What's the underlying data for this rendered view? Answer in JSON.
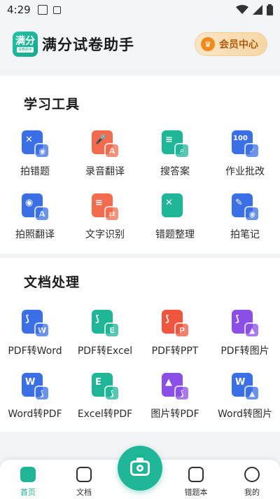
{
  "status_bar": {
    "time": "4:29",
    "icons": [
      "photo-notification-icon",
      "app-notification-icon",
      "wifi-icon",
      "signal-icon",
      "battery-icon"
    ]
  },
  "header": {
    "logo": {
      "text": "满分",
      "small": "试卷助手"
    },
    "title": "满分试卷助手",
    "vip_label": "会员中心",
    "vip_icon": "crown-icon"
  },
  "learning_tools": {
    "title": "学习工具",
    "items": [
      {
        "label": "拍错题",
        "icon": "wrong-question-camera-icon",
        "color": "#3b6fe6",
        "mark": "✕",
        "sub": "◉"
      },
      {
        "label": "录音翻译",
        "icon": "recording-translate-icon",
        "color": "#f26b4e",
        "mark": "🎤",
        "sub": "A"
      },
      {
        "label": "搜答案",
        "icon": "search-answer-icon",
        "color": "#1fb597",
        "mark": "≡",
        "sub": "⌕"
      },
      {
        "label": "作业批改",
        "icon": "homework-correction-icon",
        "color": "#3b6fe6",
        "mark": "100",
        "sub": "✓"
      },
      {
        "label": "拍照翻译",
        "icon": "photo-translate-icon",
        "color": "#3b6fe6",
        "mark": "◉",
        "sub": "A"
      },
      {
        "label": "文字识别",
        "icon": "text-recognition-icon",
        "color": "#f26b4e",
        "mark": "≡",
        "sub": "⇄"
      },
      {
        "label": "错题整理",
        "icon": "wrong-question-organize-icon",
        "color": "#1fb597",
        "mark": "✕",
        "sub": ""
      },
      {
        "label": "拍笔记",
        "icon": "note-camera-icon",
        "color": "#3b6fe6",
        "mark": "✎",
        "sub": "◉"
      }
    ]
  },
  "document_tools": {
    "title": "文档处理",
    "items": [
      {
        "label": "PDF转Word",
        "icon": "pdf-to-word-icon",
        "color": "#3b6fe6",
        "mark": "⟆",
        "sub": "W"
      },
      {
        "label": "PDF转Excel",
        "icon": "pdf-to-excel-icon",
        "color": "#1fb597",
        "mark": "⟆",
        "sub": "E"
      },
      {
        "label": "PDF转PPT",
        "icon": "pdf-to-ppt-icon",
        "color": "#f0553e",
        "mark": "⟆",
        "sub": "P"
      },
      {
        "label": "PDF转图片",
        "icon": "pdf-to-image-icon",
        "color": "#8a4fe6",
        "mark": "⟆",
        "sub": "▲"
      },
      {
        "label": "Word转PDF",
        "icon": "word-to-pdf-icon",
        "color": "#3b6fe6",
        "mark": "W",
        "sub": "⟆"
      },
      {
        "label": "Excel转PDF",
        "icon": "excel-to-pdf-icon",
        "color": "#1fb597",
        "mark": "E",
        "sub": "⟆"
      },
      {
        "label": "图片转PDF",
        "icon": "image-to-pdf-icon",
        "color": "#8a4fe6",
        "mark": "▲",
        "sub": "⟆"
      },
      {
        "label": "Word转图片",
        "icon": "word-to-image-icon",
        "color": "#3b6fe6",
        "mark": "W",
        "sub": "▲"
      }
    ]
  },
  "tabbar": {
    "tabs": [
      {
        "label": "首页",
        "icon": "home-icon",
        "active": true
      },
      {
        "label": "文档",
        "icon": "document-icon",
        "active": false
      },
      {
        "label": "",
        "icon": "camera-icon",
        "active": false
      },
      {
        "label": "错题本",
        "icon": "wrong-question-book-icon",
        "active": false
      },
      {
        "label": "我的",
        "icon": "profile-icon",
        "active": false
      }
    ],
    "accent": "#1fb597"
  }
}
